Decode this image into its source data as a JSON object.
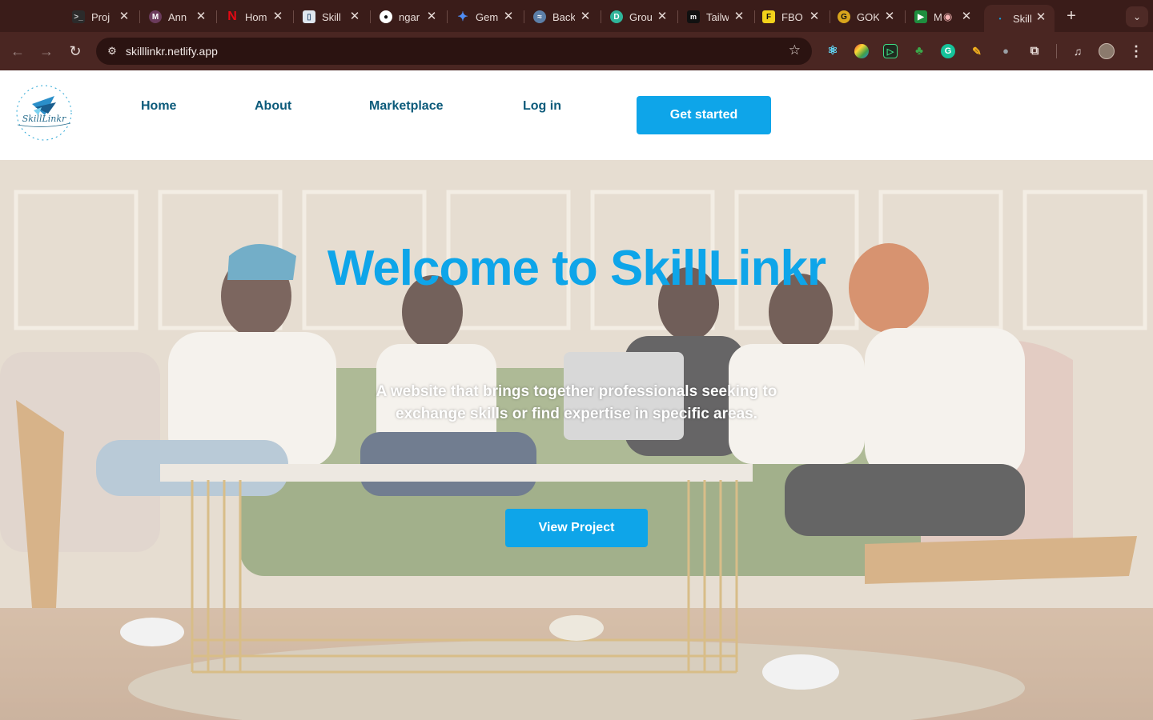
{
  "browser": {
    "tabs": [
      {
        "title": "Proj",
        "icon": "terminal-favicon",
        "color": "#2b2b2b"
      },
      {
        "title": "Ann",
        "icon": "mk-favicon",
        "color": "#6b3b5c"
      },
      {
        "title": "Hom",
        "icon": "netflix-favicon",
        "color": "#e50914"
      },
      {
        "title": "Skill",
        "icon": "trello-favicon",
        "color": "#dfe6ee"
      },
      {
        "title": "ngar",
        "icon": "github-favicon",
        "color": "#ffffff"
      },
      {
        "title": "Gem",
        "icon": "gemini-favicon",
        "color": "#4f8df5"
      },
      {
        "title": "Back",
        "icon": "backend-favicon",
        "color": "#5c7fa8"
      },
      {
        "title": "Grou",
        "icon": "groupme-favicon",
        "color": "#2fb59a"
      },
      {
        "title": "Tailw",
        "icon": "medium-favicon",
        "color": "#111111"
      },
      {
        "title": "FBO",
        "icon": "fbo-favicon",
        "color": "#f2d21b"
      },
      {
        "title": "GOK",
        "icon": "gok-favicon",
        "color": "#d9a51c"
      },
      {
        "title": "M",
        "icon": "meet-favicon",
        "color": "#1e8e3e"
      },
      {
        "title": "Skill",
        "icon": "skilllinkr-favicon",
        "color": "#0ea5e9",
        "active": true
      }
    ],
    "url": "skilllinkr.netlify.app"
  },
  "nav": {
    "items": [
      "Home",
      "About",
      "Marketplace",
      "Log in"
    ],
    "cta": "Get started",
    "logo_text": "SkillLinkr"
  },
  "hero": {
    "title": "Welcome to SkillLinkr",
    "subtitle": "A website that brings together professionals seeking to exchange skills or find expertise in specific areas.",
    "button": "View Project"
  },
  "colors": {
    "accent": "#0ea5e9",
    "nav_text": "#0b5a7a",
    "chrome_bg": "#3a1c19"
  }
}
